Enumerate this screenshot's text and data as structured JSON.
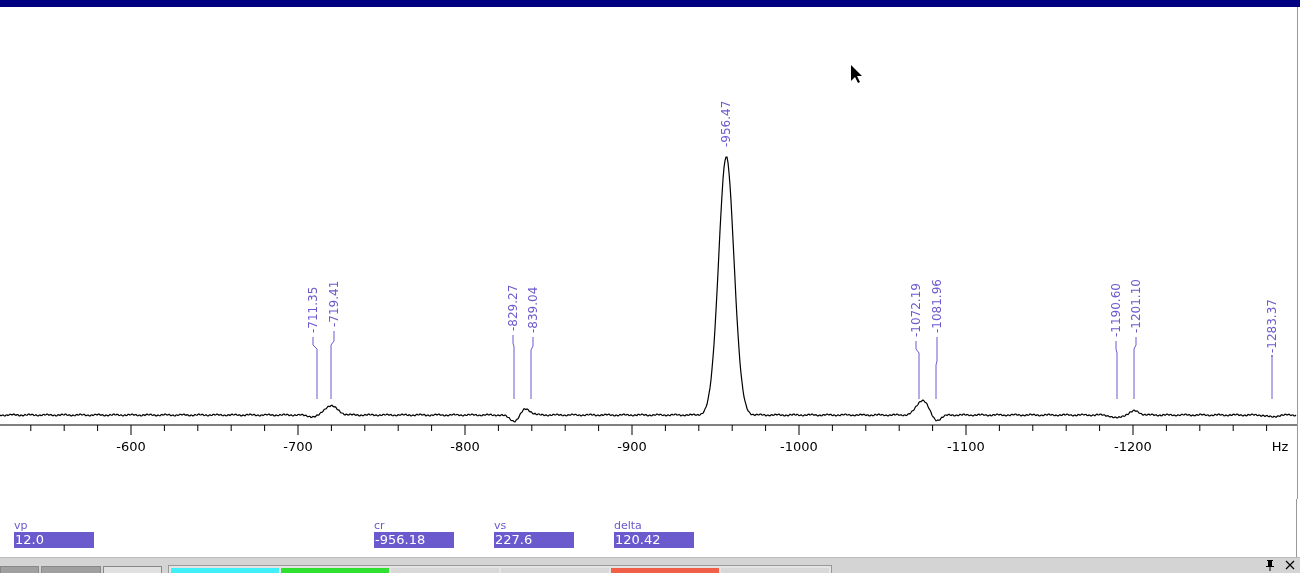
{
  "spectrum": {
    "unit": "Hz",
    "ticks": [
      "-600",
      "-700",
      "-800",
      "-900",
      "-1000",
      "-1100",
      "-1200"
    ],
    "peaks": [
      {
        "label": "-711.35"
      },
      {
        "label": "-719.41"
      },
      {
        "label": "-829.27"
      },
      {
        "label": "-839.04"
      },
      {
        "label": "-956.47"
      },
      {
        "label": "-1072.19"
      },
      {
        "label": "-1081.96"
      },
      {
        "label": "-1190.60"
      },
      {
        "label": "-1201.10"
      },
      {
        "label": "-1283.37"
      }
    ]
  },
  "parameters": [
    {
      "name": "vp",
      "value": "12.0"
    },
    {
      "name": "cr",
      "value": "-956.18"
    },
    {
      "name": "vs",
      "value": "227.6"
    },
    {
      "name": "delta",
      "value": "120.42"
    }
  ],
  "toolbar": {
    "tabs": [
      {
        "selected": false
      },
      {
        "selected": false
      },
      {
        "selected": true
      }
    ],
    "segments": [
      {
        "color": "#40f0f8"
      },
      {
        "color": "#30e030"
      },
      {
        "color": "#d8d8d8"
      },
      {
        "color": "#d8d8d8"
      },
      {
        "color": "#f06048"
      },
      {
        "color": "#d8d8d8"
      }
    ]
  }
}
